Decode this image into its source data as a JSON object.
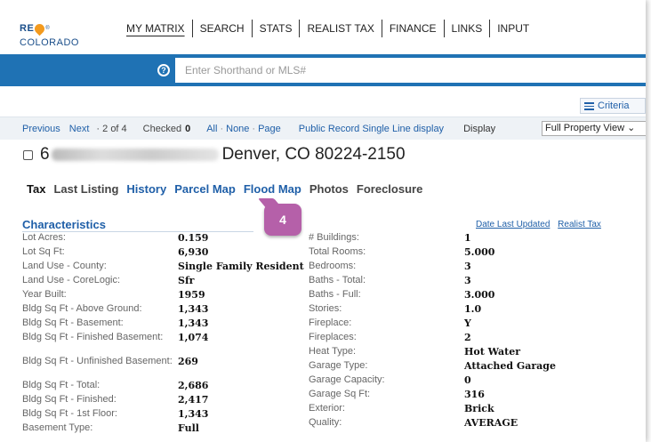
{
  "logo": {
    "re": "RE",
    "colorado": "COLORADO",
    "tm": "®"
  },
  "nav": [
    "MY MATRIX",
    "SEARCH",
    "STATS",
    "REALIST TAX",
    "FINANCE",
    "LINKS",
    "INPUT"
  ],
  "search": {
    "placeholder": "Enter Shorthand or MLS#",
    "help_icon": "question-circle-icon"
  },
  "criteria_label": "Criteria",
  "pager": {
    "previous": "Previous",
    "next": "Next",
    "position": "· 2 of 4",
    "checked_label": "Checked",
    "checked_count": "0",
    "all": "All",
    "none": "None",
    "page": "Page",
    "public_record": "Public Record Single Line display",
    "display_label": "Display",
    "display_value": "Full Property View"
  },
  "address": {
    "number_prefix": "6",
    "city_line": "Denver, CO 80224-2150"
  },
  "tabs": [
    {
      "label": "Tax",
      "state": "active"
    },
    {
      "label": "Last Listing",
      "state": "plain"
    },
    {
      "label": "History",
      "state": "link"
    },
    {
      "label": "Parcel Map",
      "state": "link"
    },
    {
      "label": "Flood Map",
      "state": "link"
    },
    {
      "label": "Photos",
      "state": "plain"
    },
    {
      "label": "Foreclosure",
      "state": "plain"
    }
  ],
  "badge": "4",
  "characteristics": {
    "title": "Characteristics",
    "date_last_updated": "Date Last Updated",
    "realist_tax": "Realist Tax",
    "left": [
      {
        "label": "Lot Acres:",
        "value": "0.159"
      },
      {
        "label": "Lot Sq Ft:",
        "value": "6,930"
      },
      {
        "label": "Land Use - County:",
        "value": "Single Family Resident"
      },
      {
        "label": "Land Use - CoreLogic:",
        "value": "Sfr"
      },
      {
        "label": "Year Built:",
        "value": "1959"
      },
      {
        "label": "Bldg Sq Ft - Above Ground:",
        "value": "1,343"
      },
      {
        "label": "Bldg Sq Ft - Basement:",
        "value": "1,343"
      },
      {
        "label": "Bldg Sq Ft - Finished Basement:",
        "value": "1,074"
      },
      {
        "label": "Bldg Sq Ft - Unfinished Basement:",
        "value": "269"
      },
      {
        "label": "Bldg Sq Ft - Total:",
        "value": "2,686"
      },
      {
        "label": "Bldg Sq Ft - Finished:",
        "value": "2,417"
      },
      {
        "label": "Bldg Sq Ft - 1st Floor:",
        "value": "1,343"
      },
      {
        "label": "Basement Type:",
        "value": "Full"
      }
    ],
    "right": [
      {
        "label": "# Buildings:",
        "value": "1"
      },
      {
        "label": "Total Rooms:",
        "value": "5.000"
      },
      {
        "label": "Bedrooms:",
        "value": "3"
      },
      {
        "label": "Baths - Total:",
        "value": "3"
      },
      {
        "label": "Baths - Full:",
        "value": "3.000"
      },
      {
        "label": "Stories:",
        "value": "1.0"
      },
      {
        "label": "Fireplace:",
        "value": "Y"
      },
      {
        "label": "Fireplaces:",
        "value": "2"
      },
      {
        "label": "Heat Type:",
        "value": "Hot Water"
      },
      {
        "label": "Garage Type:",
        "value": "Attached Garage"
      },
      {
        "label": "Garage Capacity:",
        "value": "0"
      },
      {
        "label": "Garage Sq Ft:",
        "value": "316"
      },
      {
        "label": "Exterior:",
        "value": "Brick"
      },
      {
        "label": "Quality:",
        "value": "AVERAGE"
      }
    ]
  }
}
